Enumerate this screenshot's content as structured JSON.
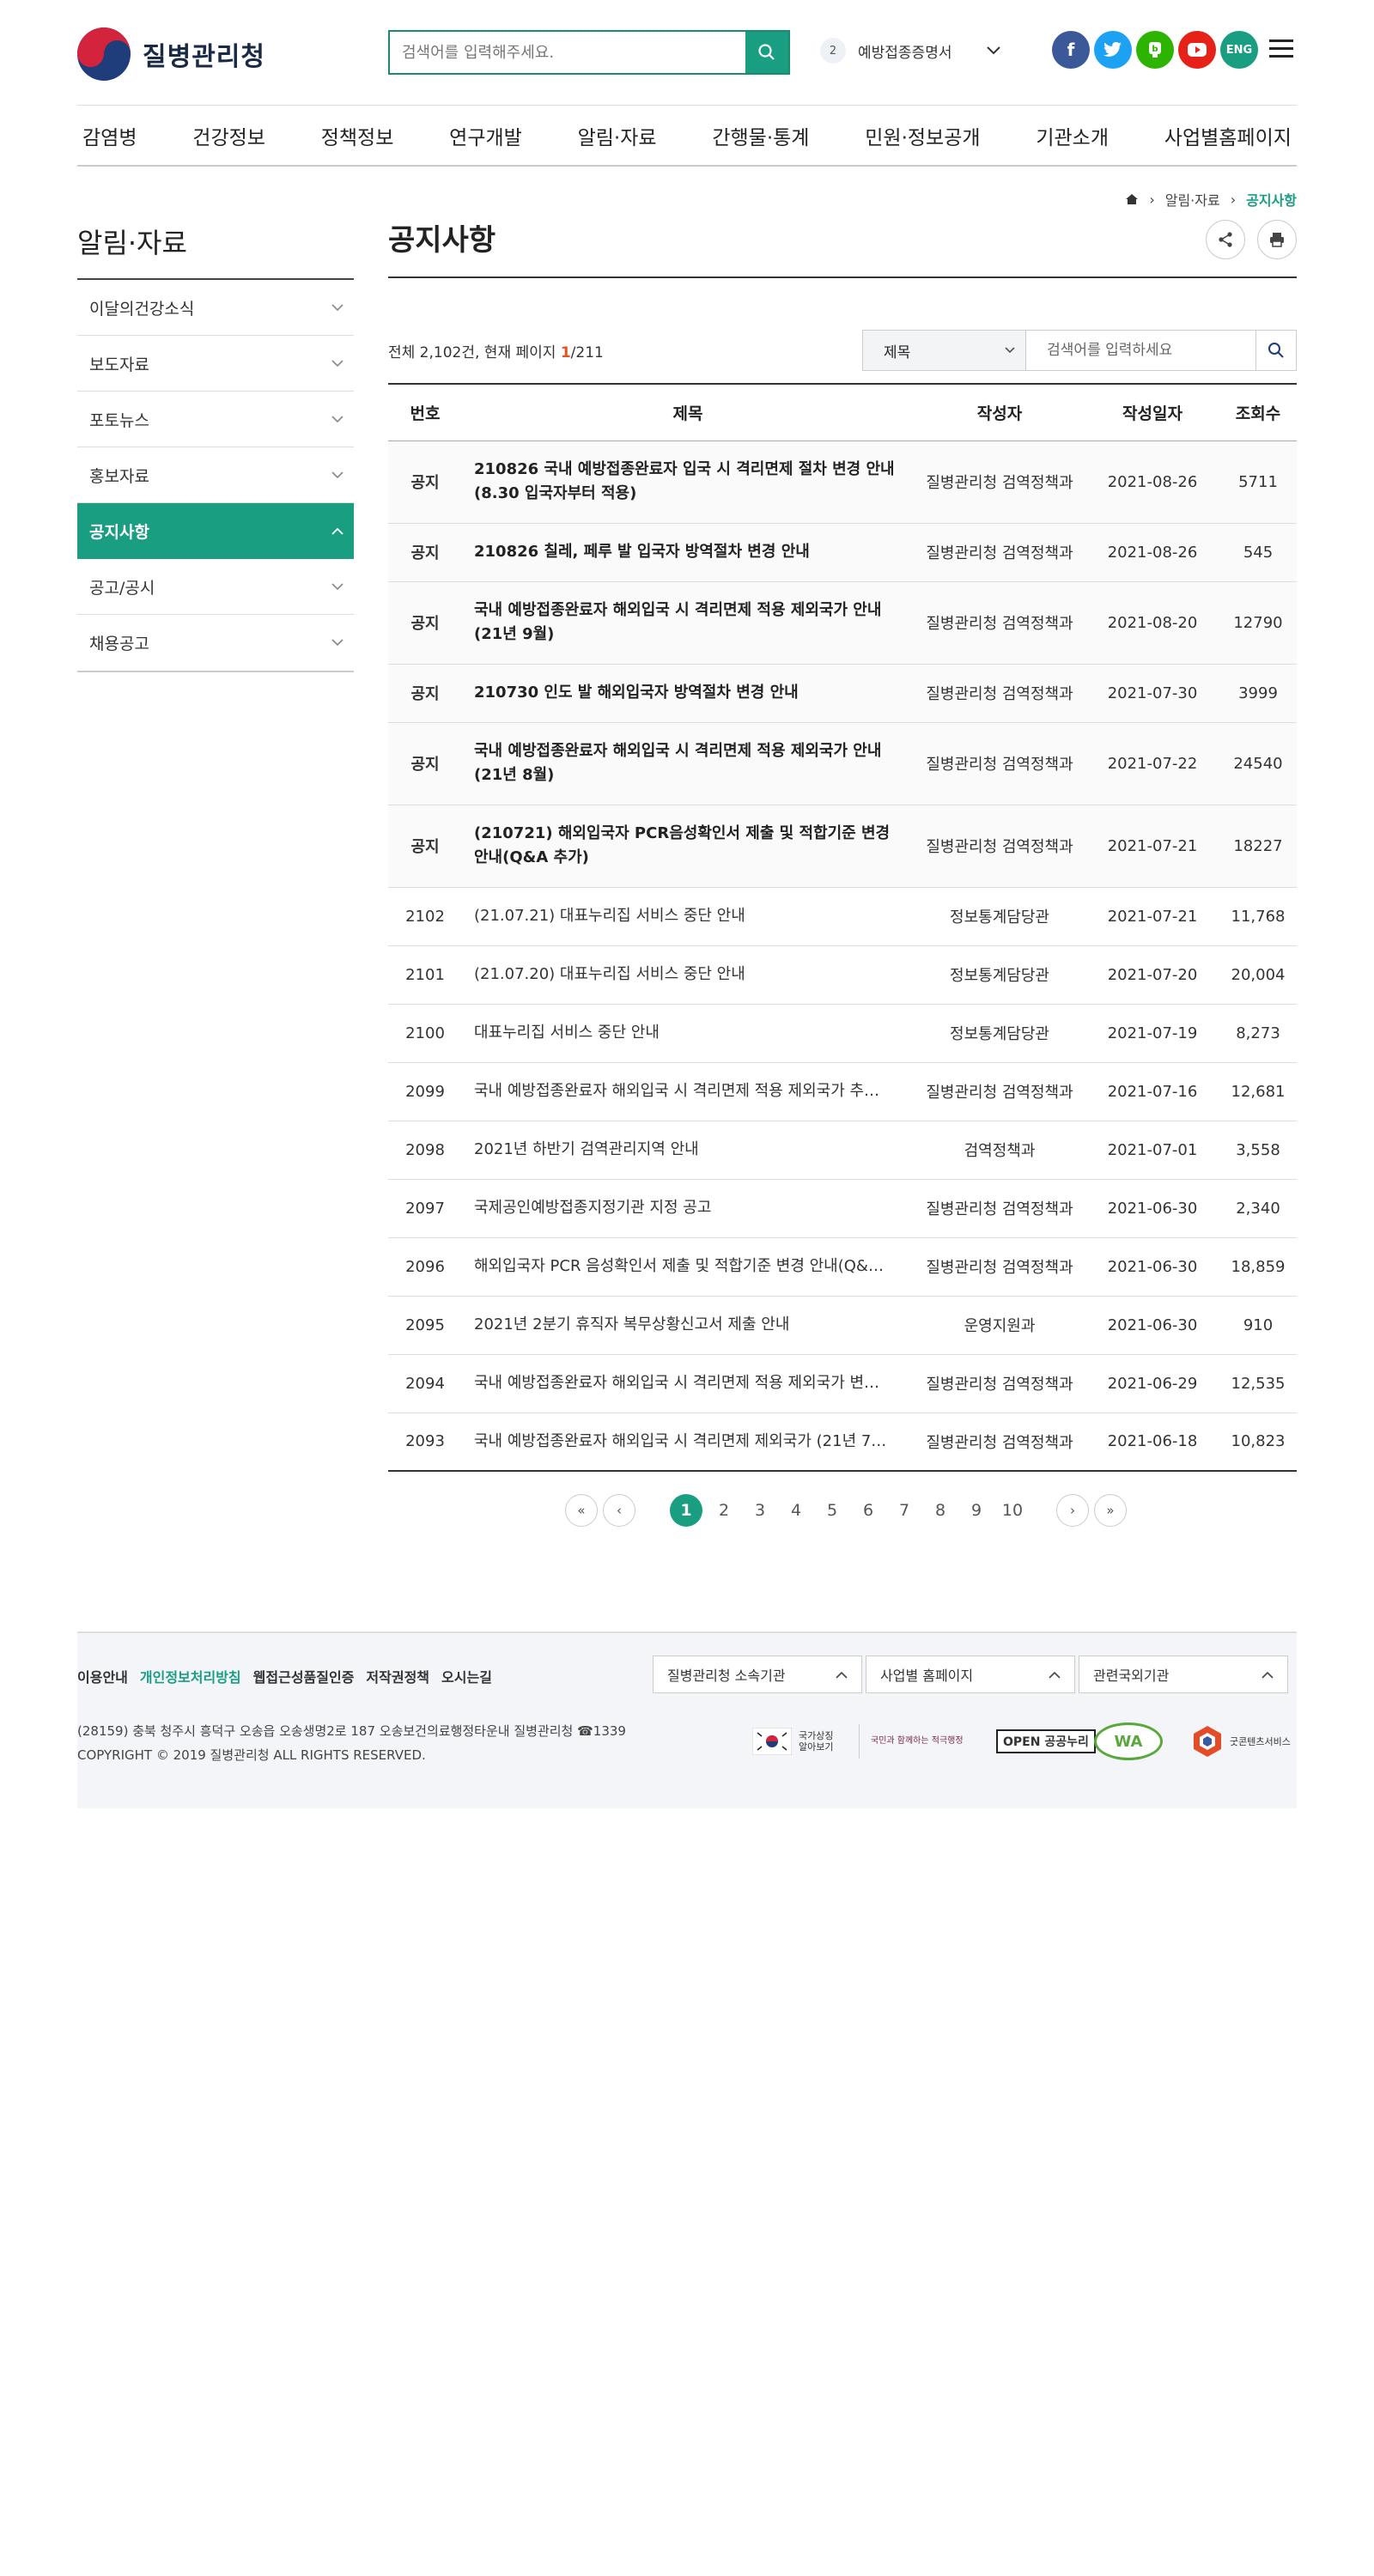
{
  "header": {
    "logo_text": "질병관리청",
    "search_placeholder": "검색어를 입력해주세요.",
    "ticker_num": "2",
    "ticker_text": "예방접종증명서",
    "lang_label": "ENG"
  },
  "gnb": [
    "감염병",
    "건강정보",
    "정책정보",
    "연구개발",
    "알림·자료",
    "간행물·통계",
    "민원·정보공개",
    "기관소개",
    "사업별홈페이지"
  ],
  "lnb": {
    "title": "알림·자료",
    "items": [
      "이달의건강소식",
      "보도자료",
      "포토뉴스",
      "홍보자료",
      "공지사항",
      "공고/공시",
      "채용공고"
    ]
  },
  "breadcrumb": {
    "level1": "알림·자료",
    "current": "공지사항"
  },
  "page_title": "공지사항",
  "list_info": {
    "prefix": "전체 2,102건, 현재 페이지 ",
    "current_page": "1",
    "total_pages": "/211"
  },
  "filter": {
    "selected": "제목",
    "placeholder": "검색어를 입력하세요"
  },
  "table": {
    "headers": [
      "번호",
      "제목",
      "작성자",
      "작성일자",
      "조회수"
    ],
    "rows": [
      {
        "num": "공지",
        "title": "210826 국내 예방접종완료자 입국 시 격리면제 절차 변경 안내(8.30 입국자부터 적용)",
        "author": "질병관리청 검역정책과",
        "date": "2021-08-26",
        "views": "5711"
      },
      {
        "num": "공지",
        "title": "210826 칠레, 페루 발 입국자 방역절차 변경 안내",
        "author": "질병관리청 검역정책과",
        "date": "2021-08-26",
        "views": "545"
      },
      {
        "num": "공지",
        "title": "국내 예방접종완료자 해외입국 시 격리면제 적용 제외국가 안내 (21년 9월)",
        "author": "질병관리청 검역정책과",
        "date": "2021-08-20",
        "views": "12790"
      },
      {
        "num": "공지",
        "title": "210730 인도 발 해외입국자 방역절차 변경 안내",
        "author": "질병관리청 검역정책과",
        "date": "2021-07-30",
        "views": "3999"
      },
      {
        "num": "공지",
        "title": "국내 예방접종완료자 해외입국 시 격리면제 적용 제외국가 안내 (21년 8월)",
        "author": "질병관리청 검역정책과",
        "date": "2021-07-22",
        "views": "24540"
      },
      {
        "num": "공지",
        "title": "(210721) 해외입국자 PCR음성확인서 제출 및 적합기준 변경 안내(Q&A 추가)",
        "author": "질병관리청 검역정책과",
        "date": "2021-07-21",
        "views": "18227"
      },
      {
        "num": "2102",
        "title": "(21.07.21) 대표누리집 서비스 중단 안내",
        "author": "정보통계담당관",
        "date": "2021-07-21",
        "views": "11,768"
      },
      {
        "num": "2101",
        "title": "(21.07.20) 대표누리집 서비스 중단 안내",
        "author": "정보통계담당관",
        "date": "2021-07-20",
        "views": "20,004"
      },
      {
        "num": "2100",
        "title": "대표누리집 서비스 중단 안내",
        "author": "정보통계담당관",
        "date": "2021-07-19",
        "views": "8,273"
      },
      {
        "num": "2099",
        "title": "국내 예방접종완료자 해외입국 시 격리면제 적용 제외국가 추…",
        "author": "질병관리청 검역정책과",
        "date": "2021-07-16",
        "views": "12,681"
      },
      {
        "num": "2098",
        "title": "2021년 하반기 검역관리지역 안내",
        "author": "검역정책과",
        "date": "2021-07-01",
        "views": "3,558"
      },
      {
        "num": "2097",
        "title": "국제공인예방접종지정기관 지정 공고",
        "author": "질병관리청 검역정책과",
        "date": "2021-06-30",
        "views": "2,340"
      },
      {
        "num": "2096",
        "title": "해외입국자 PCR 음성확인서 제출 및 적합기준 변경 안내(Q&…",
        "author": "질병관리청 검역정책과",
        "date": "2021-06-30",
        "views": "18,859"
      },
      {
        "num": "2095",
        "title": "2021년 2분기 휴직자 복무상황신고서 제출 안내",
        "author": "운영지원과",
        "date": "2021-06-30",
        "views": "910"
      },
      {
        "num": "2094",
        "title": "국내 예방접종완료자 해외입국 시 격리면제 적용 제외국가 변…",
        "author": "질병관리청 검역정책과",
        "date": "2021-06-29",
        "views": "12,535"
      },
      {
        "num": "2093",
        "title": "국내 예방접종완료자 해외입국 시 격리면제 제외국가 (21년 7…",
        "author": "질병관리청 검역정책과",
        "date": "2021-06-18",
        "views": "10,823"
      }
    ]
  },
  "pagination": [
    "1",
    "2",
    "3",
    "4",
    "5",
    "6",
    "7",
    "8",
    "9",
    "10"
  ],
  "footer": {
    "links": [
      "이용안내",
      "개인정보처리방침",
      "웹접근성품질인증",
      "저작권정책",
      "오시는길"
    ],
    "selects": [
      "질병관리청 소속기관",
      "사업별 홈페이지",
      "관련국외기관"
    ],
    "address": "(28159) 충북 청주시 흥덕구 오송읍 오송생명2로 187 오송보건의료행정타운내 질병관리청 ☎1339",
    "copyright": "COPYRIGHT © 2019 질병관리청 ALL RIGHTS RESERVED.",
    "badges": [
      "국가상징 알아보기",
      "국민과 함께하는 적극행정",
      "OPEN 공공누리",
      "WA",
      "굿콘텐츠서비스"
    ]
  },
  "colors": {
    "accent": "#1a9e82",
    "facebook": "#3b5998",
    "twitter": "#1da1f2",
    "blog": "#2db400",
    "youtube": "#e62117",
    "eng": "#1a9e82"
  }
}
